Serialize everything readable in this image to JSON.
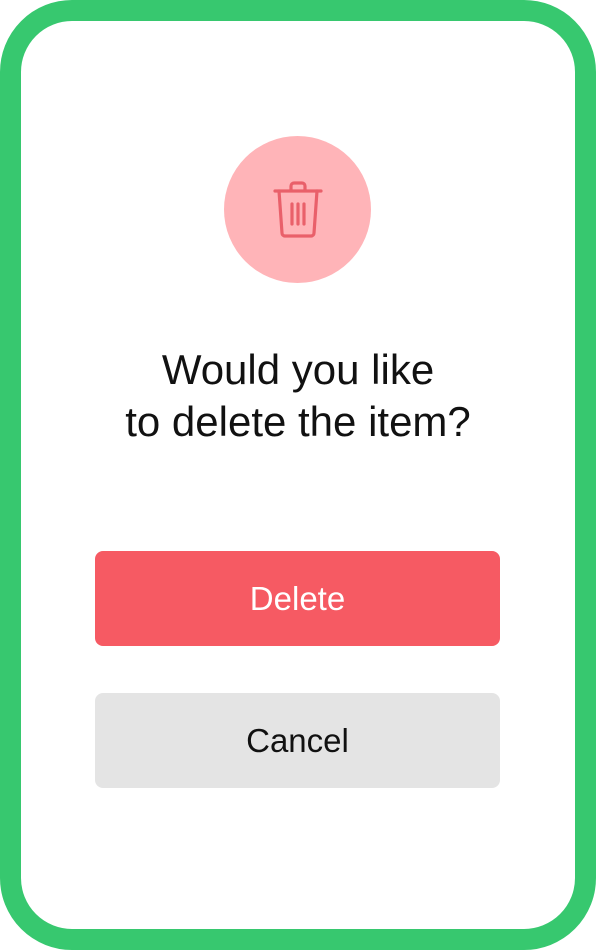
{
  "dialog": {
    "icon": "trash-icon",
    "question_line1": "Would you like",
    "question_line2": "to delete the item?",
    "delete_label": "Delete",
    "cancel_label": "Cancel"
  },
  "colors": {
    "frame": "#37c86f",
    "icon_circle": "#ffb4b8",
    "icon_stroke": "#e9606a",
    "delete_button": "#f65a63",
    "cancel_button": "#e4e4e4"
  }
}
